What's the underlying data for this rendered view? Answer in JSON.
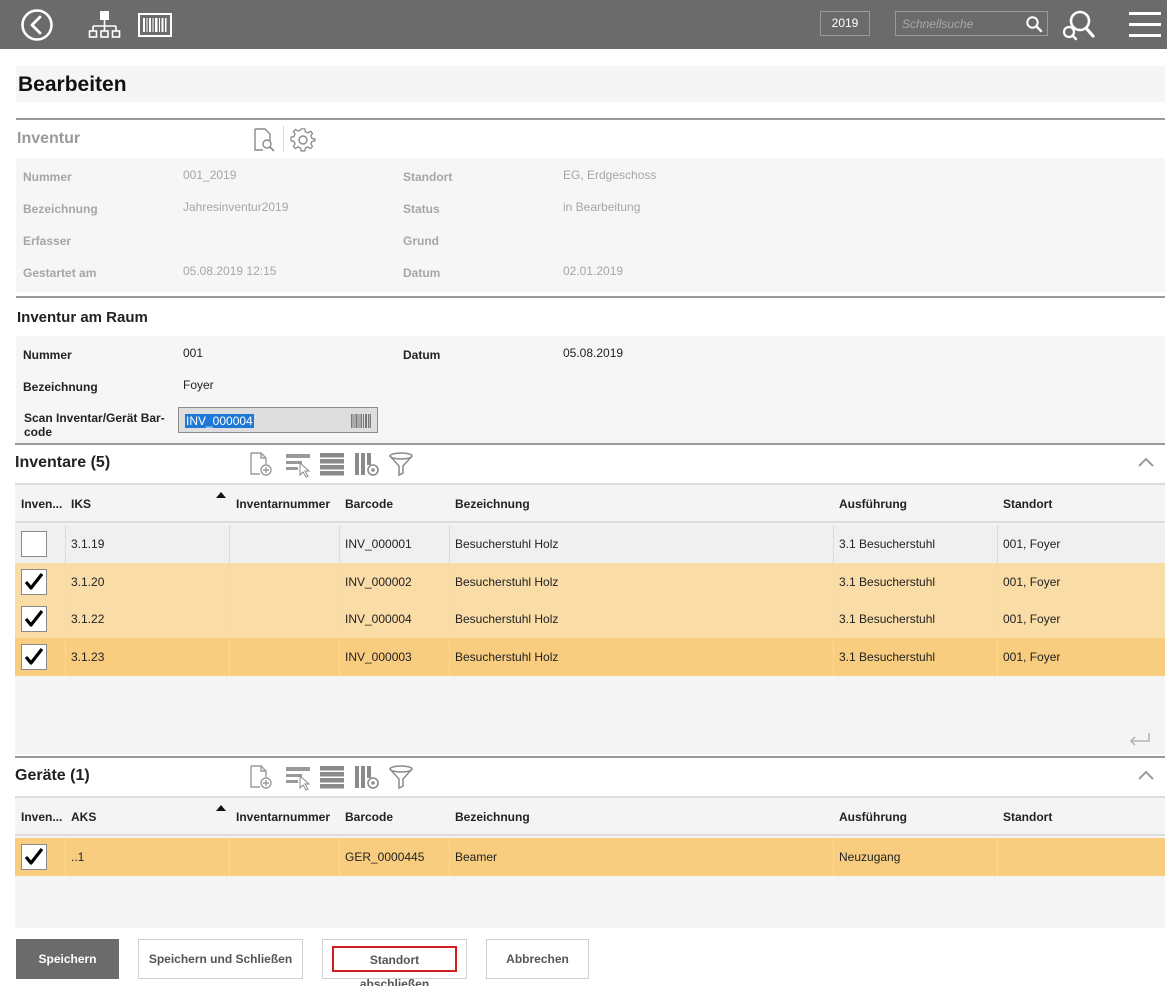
{
  "topbar": {
    "year": "2019",
    "search_placeholder": "Schnellsuche",
    "icons": [
      "back-circle-icon",
      "sitemap-icon",
      "barcode-icon",
      "search-icon",
      "advanced-search-icon",
      "hamburger-menu-icon"
    ]
  },
  "page": {
    "title": "Bearbeiten"
  },
  "inventur": {
    "title": "Inventur",
    "icons": [
      "document-search-icon",
      "settings-gear-icon"
    ],
    "fields": [
      {
        "label": "Nummer",
        "value": "001_2019"
      },
      {
        "label": "Bezeichnung",
        "value": "Jahresinventur2019"
      },
      {
        "label": "Erfasser",
        "value": ""
      },
      {
        "label": "Gestartet am",
        "value": "05.08.2019 12:15"
      },
      {
        "label": "Standort",
        "value": "EG, Erdgeschoss"
      },
      {
        "label": "Status",
        "value": "in Bearbeitung"
      },
      {
        "label": "Grund",
        "value": ""
      },
      {
        "label": "Datum",
        "value": "02.01.2019"
      }
    ]
  },
  "raum": {
    "title": "Inventur am Raum",
    "fields": [
      {
        "label": "Nummer",
        "value": "001"
      },
      {
        "label": "Bezeichnung",
        "value": "Foyer"
      },
      {
        "label": "Datum",
        "value": "05.08.2019"
      }
    ],
    "scan_label": "Scan Inventar/Gerät Barcode",
    "scan_label_line1": "Scan Inventar/Gerät Bar-",
    "scan_label_line2": "code",
    "scan_value": "INV_000004"
  },
  "inventare": {
    "title": "Inventare (5)",
    "columns": [
      "Inven...",
      "IKS",
      "Inventarnummer",
      "Barcode",
      "Bezeichnung",
      "Ausführung",
      "Standort"
    ],
    "rows": [
      {
        "checked": false,
        "iks": "3.1.19",
        "inventarnummer": "",
        "barcode": "INV_000001",
        "bezeichnung": "Besucherstuhl Holz",
        "ausfuehrung": "3.1 Besucherstuhl",
        "standort": "001, Foyer",
        "bg": "#f0f0f0"
      },
      {
        "checked": true,
        "iks": "3.1.20",
        "inventarnummer": "",
        "barcode": "INV_000002",
        "bezeichnung": "Besucherstuhl Holz",
        "ausfuehrung": "3.1 Besucherstuhl",
        "standort": "001, Foyer",
        "bg": "#fadca7"
      },
      {
        "checked": true,
        "iks": "3.1.22",
        "inventarnummer": "",
        "barcode": "INV_000004",
        "bezeichnung": "Besucherstuhl Holz",
        "ausfuehrung": "3.1 Besucherstuhl",
        "standort": "001, Foyer",
        "bg": "#fadca7"
      },
      {
        "checked": true,
        "iks": "3.1.23",
        "inventarnummer": "",
        "barcode": "INV_000003",
        "bezeichnung": "Besucherstuhl Holz",
        "ausfuehrung": "3.1 Besucherstuhl",
        "standort": "001, Foyer",
        "bg": "#f9cd80"
      }
    ]
  },
  "geraete": {
    "title": "Geräte (1)",
    "columns": [
      "Inven...",
      "AKS",
      "Inventarnummer",
      "Barcode",
      "Bezeichnung",
      "Ausführung",
      "Standort"
    ],
    "rows": [
      {
        "checked": true,
        "iks": "..1",
        "inventarnummer": "",
        "barcode": "GER_0000445",
        "bezeichnung": "Beamer",
        "ausfuehrung": "Neuzugang",
        "standort": "",
        "bg": "#f9cd80"
      }
    ]
  },
  "grid_tool_icons": [
    "add-document-icon",
    "select-rows-icon",
    "list-rows-icon",
    "column-settings-icon",
    "filter-icon"
  ],
  "buttons": {
    "save": "Speichern",
    "save_close": "Speichern und Schließen",
    "close_location": "Standort abschließen",
    "cancel": "Abbrechen"
  },
  "colors": {
    "topbar": "#6b6b6b",
    "row_checked": "#fadca7",
    "row_selected": "#f9cd80",
    "focus_outline": "#d21e1e"
  }
}
